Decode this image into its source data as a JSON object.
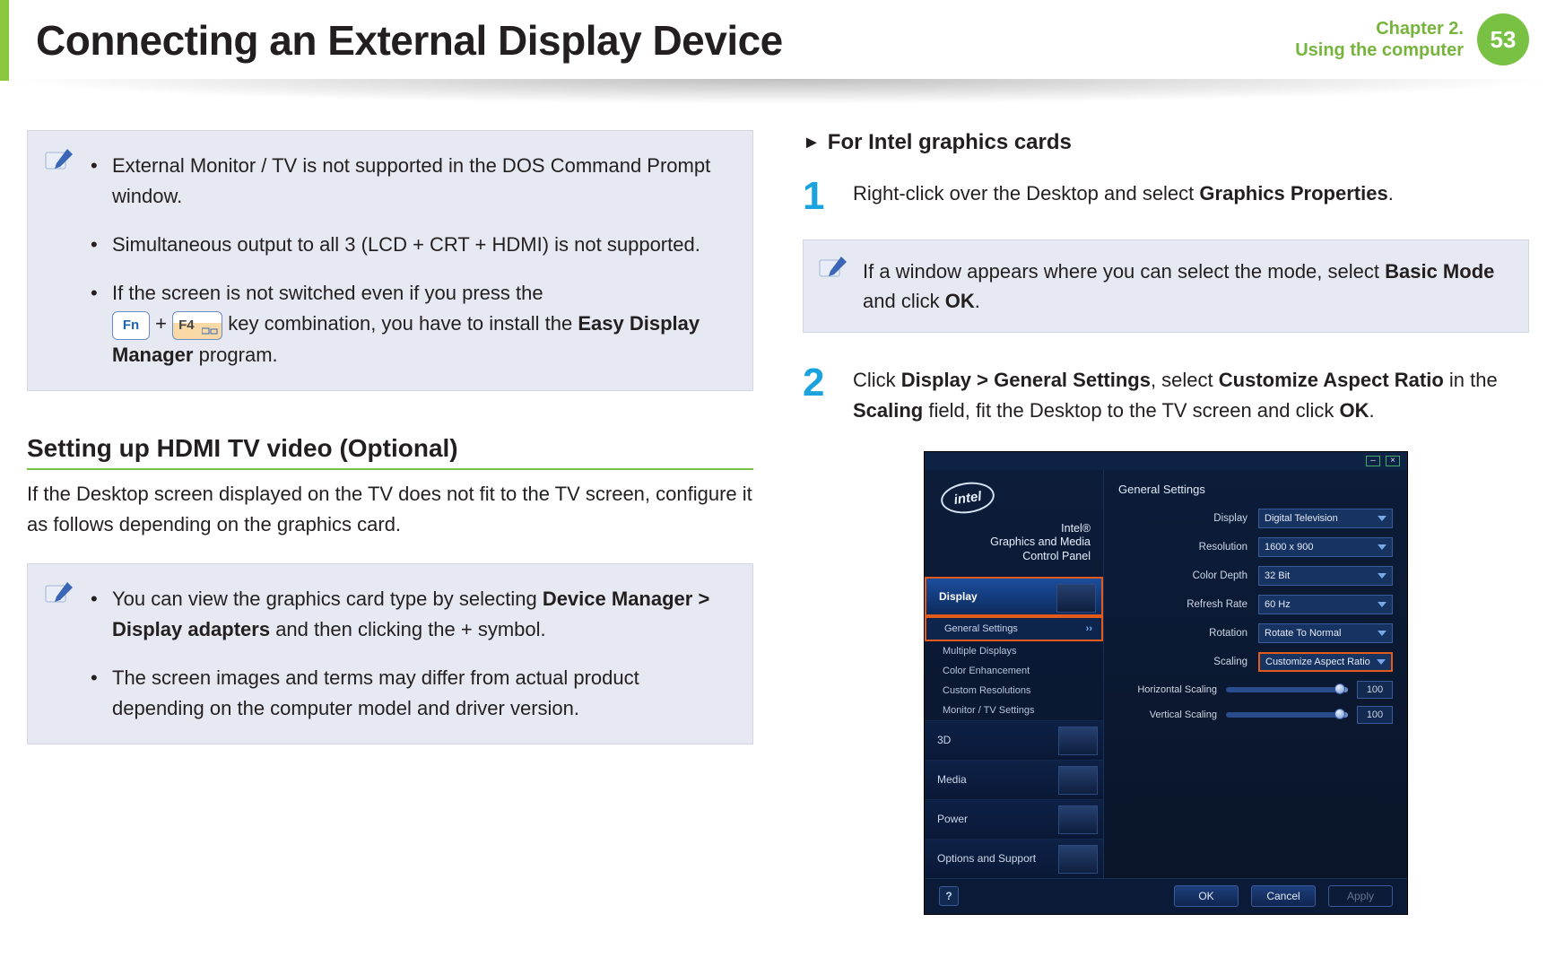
{
  "header": {
    "title": "Connecting an External Display Device",
    "chapter_line1": "Chapter 2.",
    "chapter_line2": "Using the computer",
    "page_number": "53"
  },
  "left": {
    "notes1": {
      "b1": "External Monitor / TV is not supported in the DOS Command Prompt window.",
      "b2": "Simultaneous output to all 3 (LCD + CRT + HDMI) is not supported.",
      "b3_a": "If the screen is not switched even if you press the",
      "b3_key_fn": "Fn",
      "b3_key_f4": "F4",
      "b3_b": " key combination, you have to install the ",
      "b3_bold": "Easy Display Manager",
      "b3_c": " program."
    },
    "sec_heading": "Setting up HDMI TV video (Optional)",
    "sec_body": "If the Desktop screen displayed on the TV does not fit to the TV screen, configure it as follows depending on the graphics card.",
    "notes2": {
      "b1_a": "You can view the graphics card type by selecting ",
      "b1_bold": "Device Manager > Display adapters",
      "b1_b": " and then clicking the + symbol.",
      "b2": "The screen images and terms may differ from actual product depending on the computer model and driver version."
    }
  },
  "right": {
    "sub_heading": "For Intel graphics cards",
    "step1_a": "Right-click over the Desktop and select ",
    "step1_bold": "Graphics Properties",
    "step1_b": ".",
    "note_a": "If a window appears where you can select the mode, select ",
    "note_bold1": "Basic Mode",
    "note_mid": " and click ",
    "note_bold2": "OK",
    "note_end": ".",
    "step2_a": "Click ",
    "step2_b1": "Display > General Settings",
    "step2_b": ", select ",
    "step2_b2": "Customize Aspect Ratio",
    "step2_c": " in the ",
    "step2_b3": "Scaling",
    "step2_d": " field, fit the Desktop to the TV screen and click ",
    "step2_b4": "OK",
    "step2_e": "."
  },
  "intel": {
    "brand": "intel",
    "name_l1": "Intel®",
    "name_l2": "Graphics and Media",
    "name_l3": "Control Panel",
    "side": {
      "display": "Display",
      "general": "General Settings",
      "multi": "Multiple Displays",
      "color": "Color Enhancement",
      "custom": "Custom Resolutions",
      "montv": "Monitor / TV Settings",
      "three_d": "3D",
      "media": "Media",
      "power": "Power",
      "options": "Options and Support"
    },
    "main": {
      "title": "General Settings",
      "labels": {
        "display": "Display",
        "resolution": "Resolution",
        "colordepth": "Color Depth",
        "refresh": "Refresh Rate",
        "rotation": "Rotation",
        "scaling": "Scaling",
        "hscale": "Horizontal Scaling",
        "vscale": "Vertical Scaling"
      },
      "values": {
        "display": "Digital Television",
        "resolution": "1600 x 900",
        "colordepth": "32 Bit",
        "refresh": "60 Hz",
        "rotation": "Rotate To Normal",
        "scaling": "Customize Aspect Ratio",
        "hscale": "100",
        "vscale": "100"
      }
    },
    "footer": {
      "help": "?",
      "ok": "OK",
      "cancel": "Cancel",
      "apply": "Apply"
    }
  }
}
